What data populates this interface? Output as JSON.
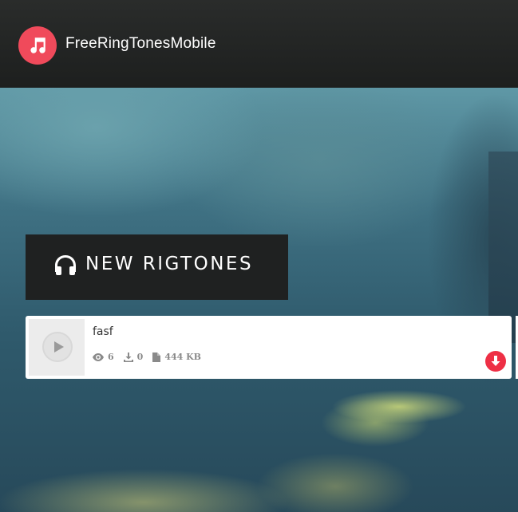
{
  "header": {
    "site_title": "FreeRingTonesMobile",
    "logo_icon": "music-note-icon",
    "logo_color": "#f04a5b"
  },
  "section": {
    "title": "NEW RIGTONES",
    "icon": "headphones-icon"
  },
  "ringtones": [
    {
      "title": "fasf",
      "views": "6",
      "downloads": "0",
      "size": "444 KB",
      "download_button_color": "#ee2f45"
    }
  ]
}
